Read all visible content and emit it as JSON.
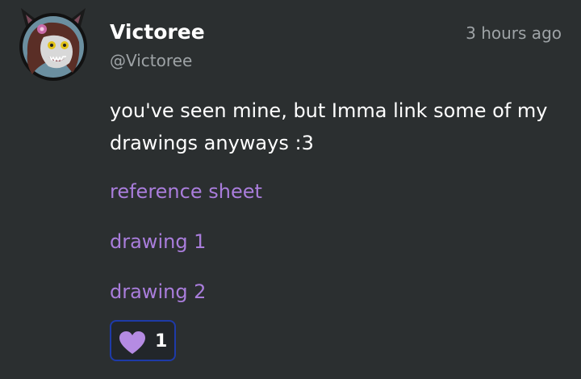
{
  "post": {
    "author": {
      "display_name": "Victoree",
      "handle": "@Victoree",
      "avatar_icon": "wolf-avatar-icon"
    },
    "timestamp": "3 hours ago",
    "body": "you've seen mine, but Imma link some of my drawings anyways :3",
    "links": [
      {
        "label": "reference sheet"
      },
      {
        "label": "drawing 1"
      },
      {
        "label": "drawing 2"
      }
    ],
    "reactions": {
      "icon": "heart-icon",
      "count": "1"
    }
  },
  "colors": {
    "background": "#2b2f30",
    "link": "#a97ddb",
    "muted_text": "#9ea3a6",
    "reaction_border": "#1e3aa8",
    "heart": "#b58be3"
  }
}
